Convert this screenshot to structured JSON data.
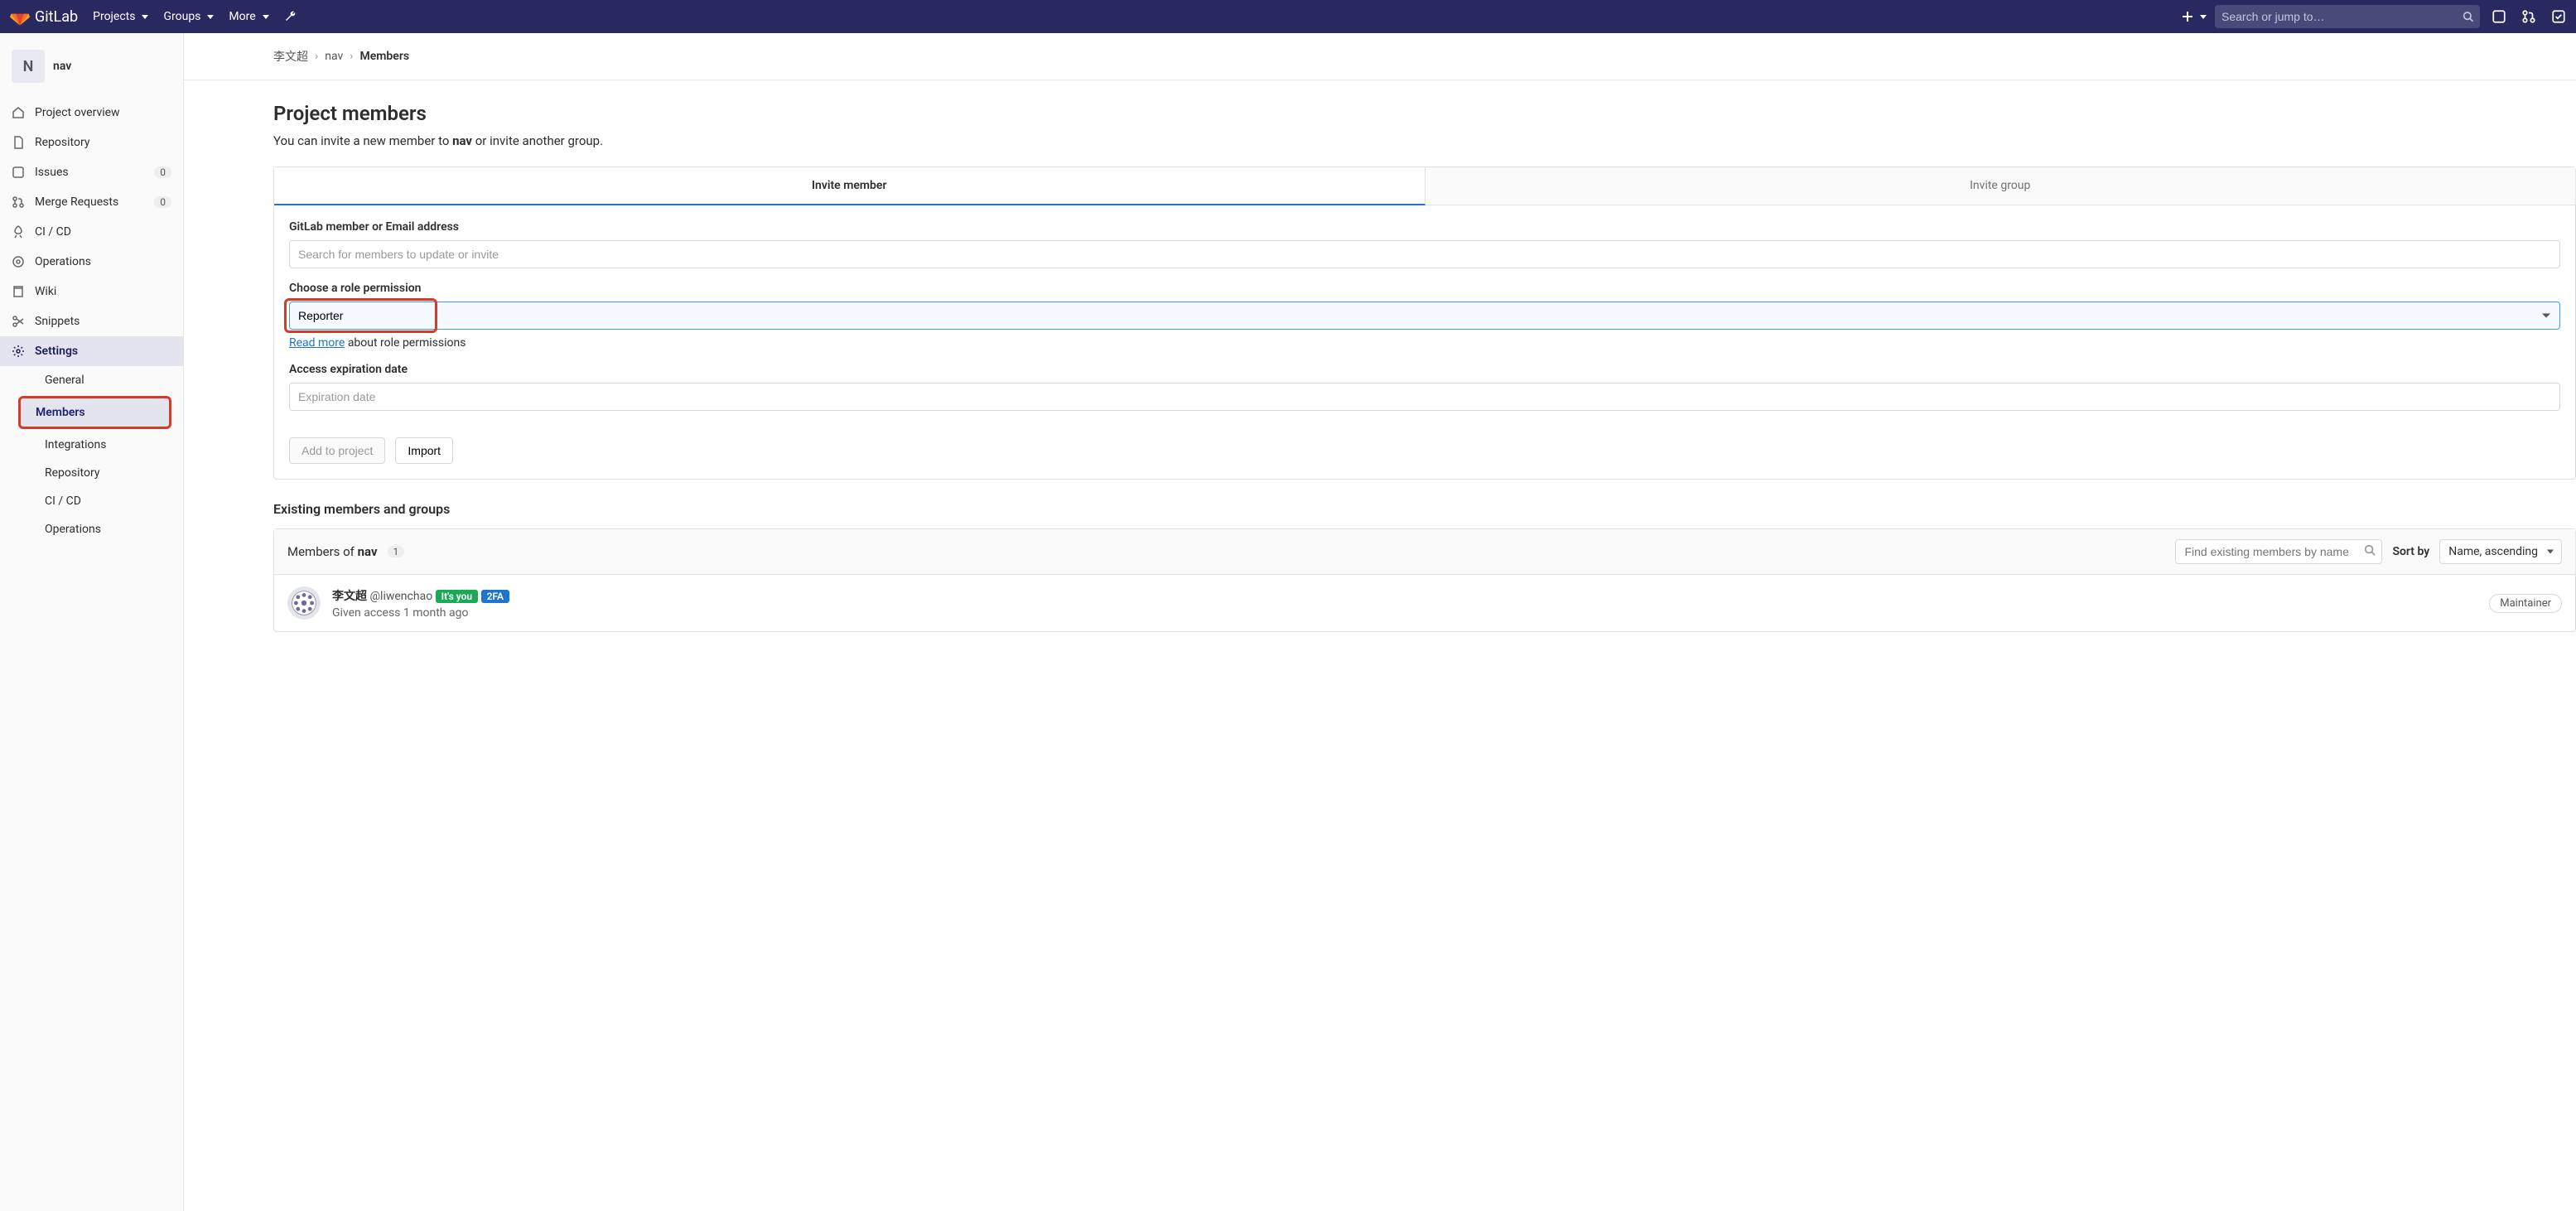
{
  "topnav": {
    "brand": "GitLab",
    "links": [
      "Projects",
      "Groups",
      "More"
    ],
    "search_placeholder": "Search or jump to…"
  },
  "sidebar": {
    "project_initial": "N",
    "project_name": "nav",
    "items": [
      {
        "label": "Project overview"
      },
      {
        "label": "Repository"
      },
      {
        "label": "Issues",
        "badge": "0"
      },
      {
        "label": "Merge Requests",
        "badge": "0"
      },
      {
        "label": "CI / CD"
      },
      {
        "label": "Operations"
      },
      {
        "label": "Wiki"
      },
      {
        "label": "Snippets"
      },
      {
        "label": "Settings"
      }
    ],
    "settings_sub": [
      "General",
      "Members",
      "Integrations",
      "Repository",
      "CI / CD",
      "Operations"
    ]
  },
  "breadcrumb": {
    "owner": "李文超",
    "project": "nav",
    "current": "Members"
  },
  "page": {
    "title": "Project members",
    "subtext_before": "You can invite a new member to ",
    "subtext_bold": "nav",
    "subtext_after": " or invite another group."
  },
  "tabs": {
    "invite_member": "Invite member",
    "invite_group": "Invite group"
  },
  "form": {
    "member_label": "GitLab member or Email address",
    "member_placeholder": "Search for members to update or invite",
    "role_label": "Choose a role permission",
    "role_value": "Reporter",
    "role_help_link": "Read more",
    "role_help_rest": " about role permissions",
    "expire_label": "Access expiration date",
    "expire_placeholder": "Expiration date",
    "add_btn": "Add to project",
    "import_btn": "Import"
  },
  "existing": {
    "heading": "Existing members and groups",
    "members_of_prefix": "Members of ",
    "members_of_bold": "nav",
    "count": "1",
    "find_placeholder": "Find existing members by name",
    "sort_label": "Sort by",
    "sort_value": "Name, ascending",
    "member": {
      "name": "李文超",
      "username": "@liwenchao",
      "its_you": "It's you",
      "twofa": "2FA",
      "access_line": "Given access 1 month ago",
      "role": "Maintainer"
    }
  }
}
